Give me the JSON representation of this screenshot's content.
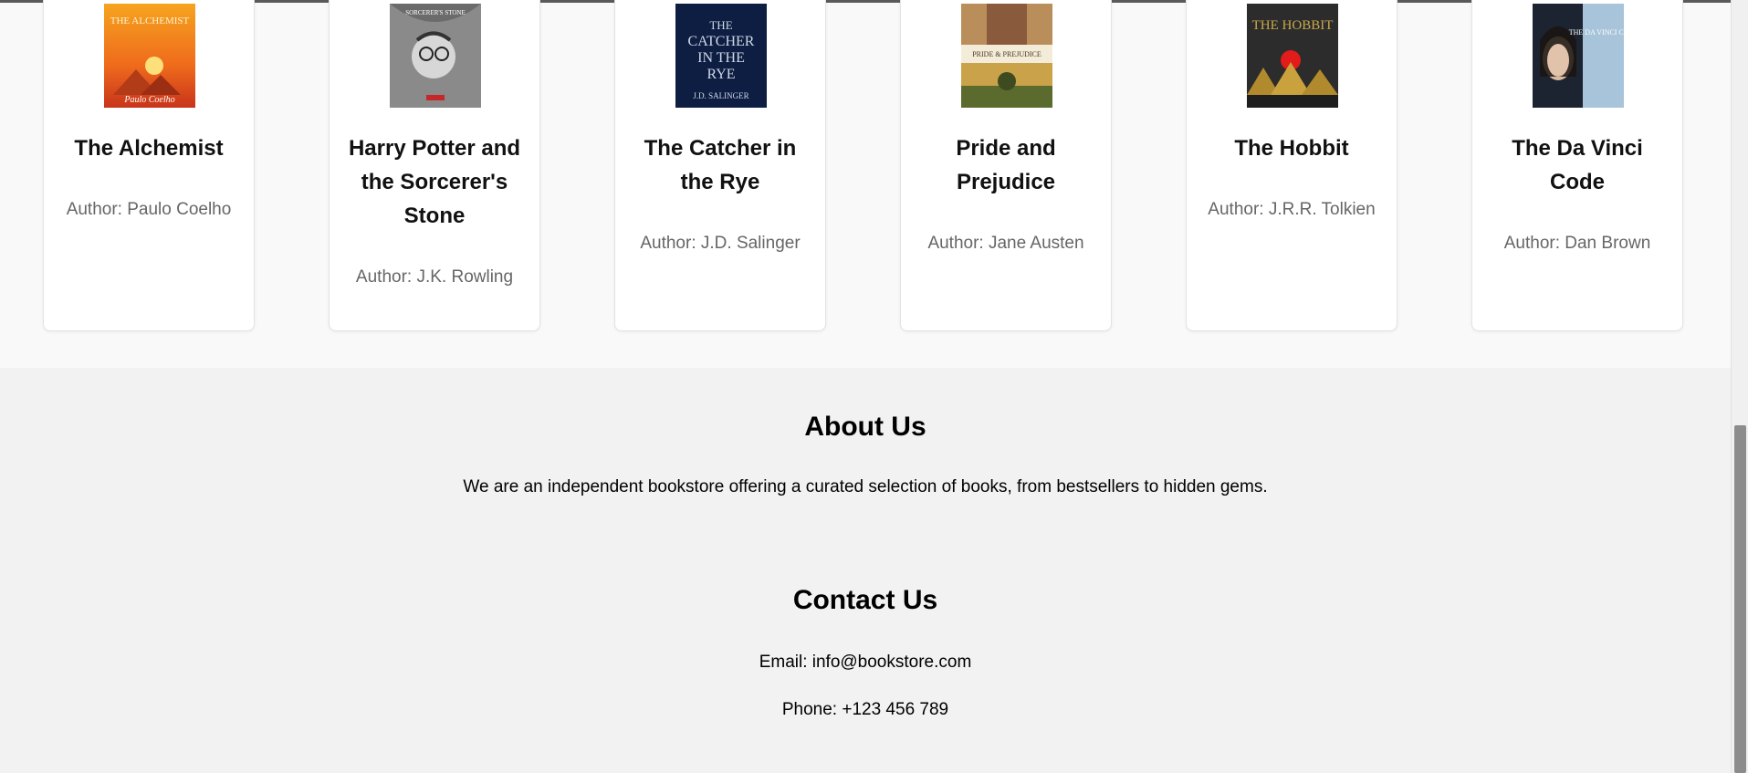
{
  "books": [
    {
      "title": "The Alchemist",
      "author": "Author: Paulo Coelho",
      "cover_text": "THE ALCHEMIST",
      "cover_sub": "Paulo Coelho"
    },
    {
      "title": "Harry Potter and the Sorcerer's Stone",
      "author": "Author: J.K. Rowling",
      "cover_text": "SORCERER'S STONE",
      "cover_sub": ""
    },
    {
      "title": "The Catcher in the Rye",
      "author": "Author: J.D. Salinger",
      "cover_text": "THE CATCHER IN THE RYE",
      "cover_sub": "J.D. SALINGER"
    },
    {
      "title": "Pride and Prejudice",
      "author": "Author: Jane Austen",
      "cover_text": "PRIDE & PREJUDICE",
      "cover_sub": ""
    },
    {
      "title": "The Hobbit",
      "author": "Author: J.R.R. Tolkien",
      "cover_text": "THE HOBBIT",
      "cover_sub": ""
    },
    {
      "title": "The Da Vinci Code",
      "author": "Author: Dan Brown",
      "cover_text": "THE DA VINCI CODE",
      "cover_sub": ""
    }
  ],
  "about": {
    "heading": "About Us",
    "text": "We are an independent bookstore offering a curated selection of books, from bestsellers to hidden gems."
  },
  "contact": {
    "heading": "Contact Us",
    "email": "Email: info@bookstore.com",
    "phone": "Phone: +123 456 789"
  }
}
